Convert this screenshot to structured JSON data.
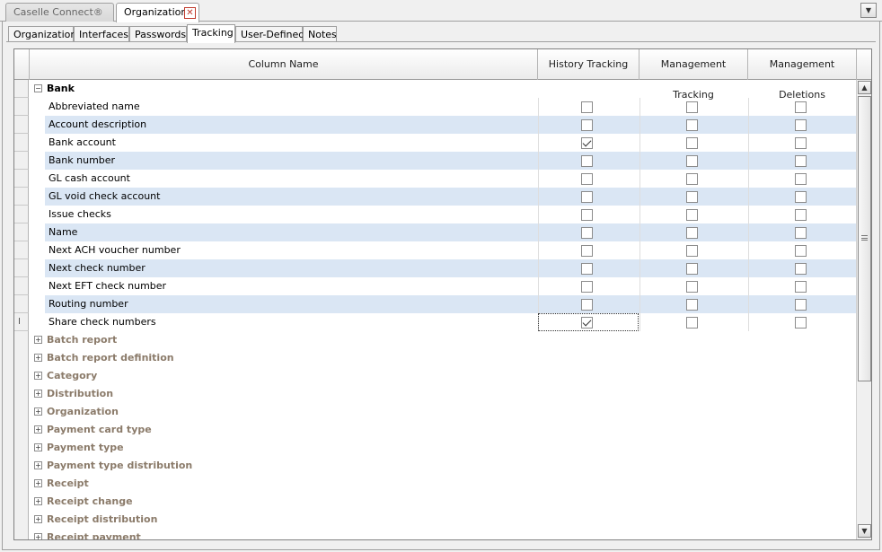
{
  "doc_tabs": [
    {
      "label": "Caselle Connect®",
      "active": false
    },
    {
      "label": "Organization",
      "active": true
    }
  ],
  "sub_tabs": [
    "Organization",
    "Interfaces",
    "Passwords",
    "Tracking",
    "User-Defined",
    "Notes"
  ],
  "active_sub_tab": "Tracking",
  "columns": [
    "Column Name",
    "History Tracking",
    "Management Tracking",
    "Management Deletions"
  ],
  "expanded_group": {
    "label": "Bank",
    "rows": [
      {
        "name": "Abbreviated name",
        "history": false,
        "management": false,
        "deletions": false
      },
      {
        "name": "Account description",
        "history": false,
        "management": false,
        "deletions": false
      },
      {
        "name": "Bank account",
        "history": true,
        "management": false,
        "deletions": false
      },
      {
        "name": "Bank number",
        "history": false,
        "management": false,
        "deletions": false
      },
      {
        "name": "GL cash account",
        "history": false,
        "management": false,
        "deletions": false
      },
      {
        "name": "GL void check account",
        "history": false,
        "management": false,
        "deletions": false
      },
      {
        "name": "Issue checks",
        "history": false,
        "management": false,
        "deletions": false
      },
      {
        "name": "Name",
        "history": false,
        "management": false,
        "deletions": false
      },
      {
        "name": "Next ACH voucher number",
        "history": false,
        "management": false,
        "deletions": false
      },
      {
        "name": "Next check number",
        "history": false,
        "management": false,
        "deletions": false
      },
      {
        "name": "Next EFT check number",
        "history": false,
        "management": false,
        "deletions": false
      },
      {
        "name": "Routing number",
        "history": false,
        "management": false,
        "deletions": false
      },
      {
        "name": "Share check numbers",
        "history": true,
        "management": false,
        "deletions": false
      }
    ]
  },
  "collapsed_groups": [
    "Batch report",
    "Batch report definition",
    "Category",
    "Distribution",
    "Organization",
    "Payment card type",
    "Payment type",
    "Payment type distribution",
    "Receipt",
    "Receipt change",
    "Receipt distribution",
    "Receipt payment"
  ],
  "icons": {
    "close": "close-icon",
    "dropdown": "chevron-down-icon",
    "expand": "plus-icon",
    "collapse": "minus-icon"
  }
}
